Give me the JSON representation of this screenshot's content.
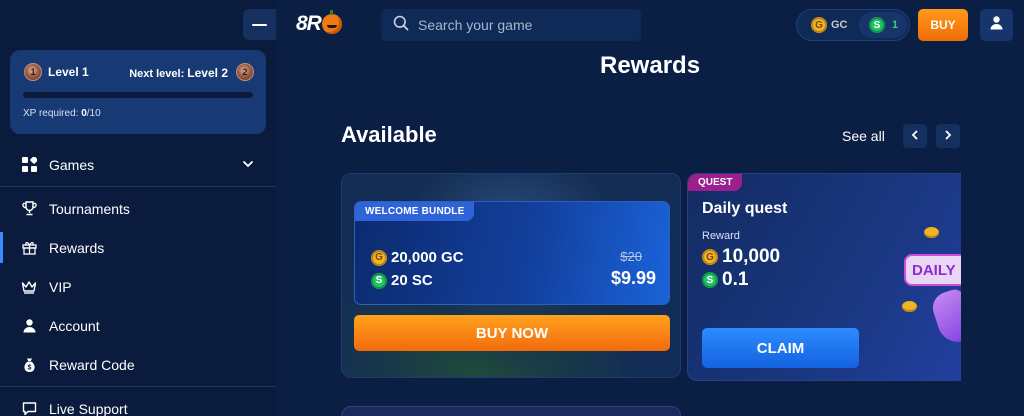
{
  "header": {
    "logo_text": "8R",
    "search_placeholder": "Search your game",
    "balance": {
      "gc_label": "GC",
      "sc_value": "1"
    },
    "buy_label": "BUY"
  },
  "sidebar": {
    "level": {
      "current": "Level 1",
      "current_badge": "1",
      "next_prefix": "Next level:",
      "next": "Level 2",
      "next_badge": "2",
      "xp_label": "XP required:",
      "xp_current": "0",
      "xp_total": "/10",
      "xp_progress": 0
    },
    "items": [
      {
        "label": "Games"
      },
      {
        "label": "Tournaments"
      },
      {
        "label": "Rewards"
      },
      {
        "label": "VIP"
      },
      {
        "label": "Account"
      },
      {
        "label": "Reward Code"
      },
      {
        "label": "Live Support"
      }
    ]
  },
  "main": {
    "title": "Rewards",
    "section_title": "Available",
    "see_all": "See all"
  },
  "bundle_card": {
    "tag": "WELCOME BUNDLE",
    "gc_amount": "20,000 GC",
    "sc_amount": "20 SC",
    "old_price": "$20",
    "price": "$9.99",
    "button": "BUY NOW"
  },
  "quest_card": {
    "tag": "QUEST",
    "title": "Daily quest",
    "reward_label": "Reward",
    "gc_amount": "10,000",
    "sc_amount": "0.1",
    "button": "CLAIM",
    "art_text": "DAILY"
  },
  "coins": {
    "gc_symbol": "G",
    "sc_symbol": "S"
  },
  "colors": {
    "background": "#0b1f44",
    "sidebar": "#0a1b3d",
    "accent_blue": "#3a8bff",
    "buy_orange": "#f06c0a",
    "quest_tag": "#9c1f8e",
    "sc_green": "#21c466",
    "gc_gold": "#f0b429"
  }
}
